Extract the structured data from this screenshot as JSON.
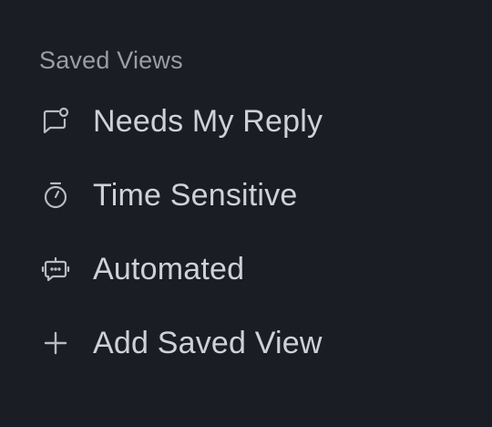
{
  "saved_views": {
    "title": "Saved Views",
    "items": [
      {
        "label": "Needs My Reply",
        "icon": "message-badge-icon"
      },
      {
        "label": "Time Sensitive",
        "icon": "stopwatch-icon"
      },
      {
        "label": "Automated",
        "icon": "robot-icon"
      }
    ],
    "add_label": "Add Saved View",
    "add_icon": "plus-icon"
  },
  "colors": {
    "background": "#1b1d24",
    "section_title": "#9a9da8",
    "item_text": "#cfd1d9",
    "icon": "#b8bbc4"
  }
}
